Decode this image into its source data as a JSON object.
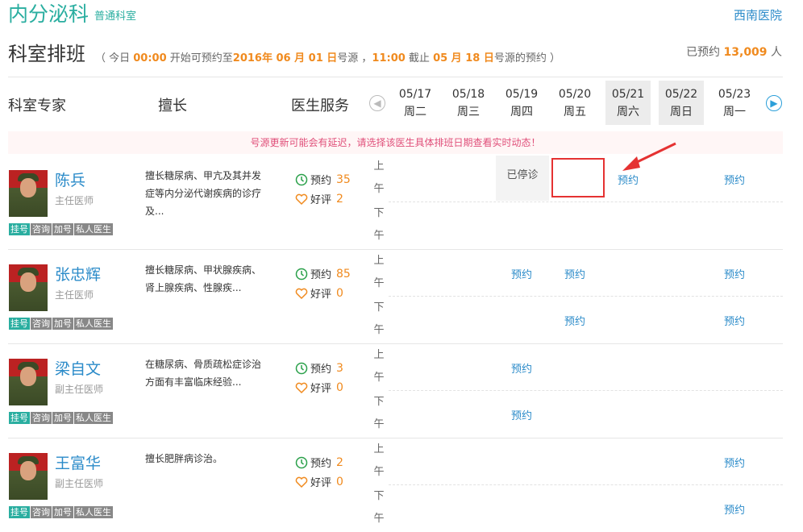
{
  "header": {
    "dept_name": "内分泌科",
    "dept_type": "普通科室",
    "hospital": "西南医院"
  },
  "schedule_header": {
    "title": "科室排班",
    "note": {
      "p1": "（ 今日 ",
      "time1": "00:00",
      "p2": " 开始可预约至",
      "date1": "2016年 06 月 01 日",
      "p3": "号源 ，",
      "time2": "11:00",
      "p4": " 截止 ",
      "date2": "05 月 18 日",
      "p5": "号源的预约 ）"
    },
    "booked_label": "已预约 ",
    "booked_count": "13,009",
    "booked_unit": " 人"
  },
  "columns": {
    "experts": "科室专家",
    "specialty": "擅长",
    "service": "医生服务",
    "prev_icon": "chevron-left-circle-icon",
    "next_icon": "chevron-right-circle-icon"
  },
  "dates": [
    {
      "date": "05/17",
      "weekday": "周二"
    },
    {
      "date": "05/18",
      "weekday": "周三"
    },
    {
      "date": "05/19",
      "weekday": "周四"
    },
    {
      "date": "05/20",
      "weekday": "周五"
    },
    {
      "date": "05/21",
      "weekday": "周六"
    },
    {
      "date": "05/22",
      "weekday": "周日"
    },
    {
      "date": "05/23",
      "weekday": "周一"
    }
  ],
  "notice": "号源更新可能会有延迟，请选择该医生具体排班日期查看实时动态！",
  "labels": {
    "am1": "上",
    "am2": "午",
    "pm1": "下",
    "pm2": "午",
    "book": "预约",
    "stopped": "已停诊",
    "booking": "预约",
    "review": "好评"
  },
  "tags": [
    "挂号",
    "咨询",
    "加号",
    "私人医生"
  ],
  "doctors": [
    {
      "name": "陈兵",
      "title": "主任医师",
      "skill": "擅长糖尿病、甲亢及其并发症等内分泌代谢疾病的诊疗及...",
      "bookings": "35",
      "reviews": "2"
    },
    {
      "name": "张忠辉",
      "title": "主任医师",
      "skill": "擅长糖尿病、甲状腺疾病、肾上腺疾病、性腺疾...",
      "bookings": "85",
      "reviews": "0"
    },
    {
      "name": "梁自文",
      "title": "副主任医师",
      "skill": "在糖尿病、骨质疏松症诊治方面有丰富临床经验...",
      "bookings": "3",
      "reviews": "0"
    },
    {
      "name": "王富华",
      "title": "副主任医师",
      "skill": "擅长肥胖病诊治。",
      "bookings": "2",
      "reviews": "0"
    }
  ],
  "colors": {
    "accent": "#2aaea0",
    "link": "#2b8bc9",
    "highlight": "#f08a1e",
    "annotation": "#e53232"
  }
}
